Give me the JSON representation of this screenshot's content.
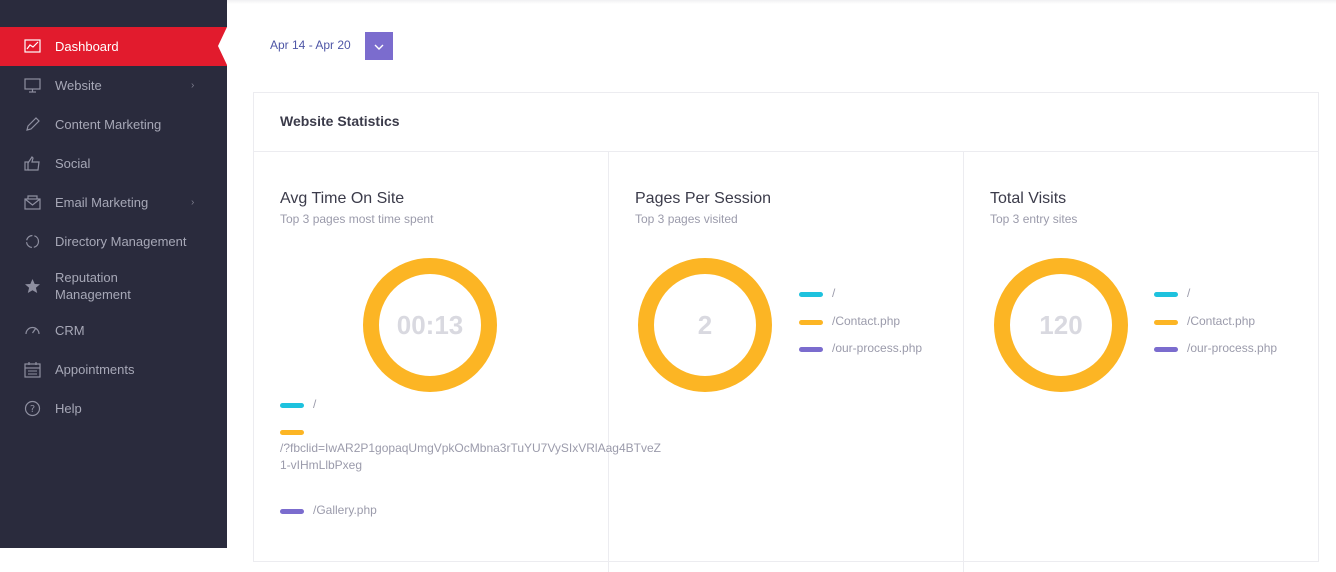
{
  "sidebar": {
    "items": [
      {
        "label": "Dashboard",
        "icon": "chart-line-icon",
        "active": true
      },
      {
        "label": "Website",
        "icon": "monitor-icon",
        "chevron": true
      },
      {
        "label": "Content Marketing",
        "icon": "pencil-icon"
      },
      {
        "label": "Social",
        "icon": "thumbs-up-icon"
      },
      {
        "label": "Email Marketing",
        "icon": "envelope-icon",
        "chevron": true
      },
      {
        "label": "Directory Management",
        "icon": "cycle-icon"
      },
      {
        "label": "Reputation Management",
        "icon": "star-icon"
      },
      {
        "label": "CRM",
        "icon": "gauge-icon"
      },
      {
        "label": "Appointments",
        "icon": "calendar-icon"
      },
      {
        "label": "Help",
        "icon": "help-icon"
      }
    ]
  },
  "header": {
    "date_range": "Apr 14 - Apr 20"
  },
  "stats": {
    "title": "Website Statistics",
    "panels": [
      {
        "title": "Avg Time On Site",
        "subtitle": "Top 3 pages most time spent",
        "value": "00:13",
        "legend": [
          "/",
          "/?fbclid=IwAR2P1gopaqUmgVpkOcMbna3rTuYU7VySIxVRlAag4BTveZ1-vIHmLlbPxeg",
          "/Gallery.php"
        ]
      },
      {
        "title": "Pages Per Session",
        "subtitle": "Top 3 pages visited",
        "value": "2",
        "legend": [
          "/",
          "/Contact.php",
          "/our-process.php"
        ]
      },
      {
        "title": "Total Visits",
        "subtitle": "Top 3 entry sites",
        "value": "120",
        "legend": [
          "/",
          "/Contact.php",
          "/our-process.php"
        ]
      }
    ]
  },
  "colors": {
    "sidebar_bg": "#2a2b3d",
    "active": "#e21b2d",
    "donut": "#fcb524",
    "legend_cyan": "#1ec2de",
    "legend_orange": "#fcb524",
    "legend_purple": "#7b6cce"
  }
}
